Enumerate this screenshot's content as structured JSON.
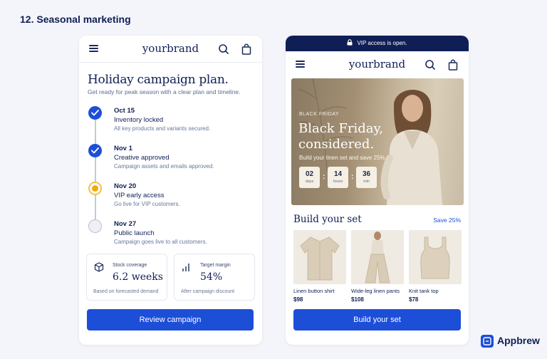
{
  "heading": "12. Seasonal marketing",
  "brand_logo": "yourbrand",
  "phone1": {
    "title": "Holiday campaign plan.",
    "subtitle": "Get ready for peak season with a clear plan and timeline.",
    "timeline": [
      {
        "date": "Oct 15",
        "name": "Inventory locked",
        "desc": "All key products and variants secured.",
        "status": "done"
      },
      {
        "date": "Nov 1",
        "name": "Creative approved",
        "desc": "Campaign assets and emails approved.",
        "status": "done"
      },
      {
        "date": "Nov 20",
        "name": "VIP early access",
        "desc": "Go live for VIP customers.",
        "status": "active"
      },
      {
        "date": "Nov 27",
        "name": "Public launch",
        "desc": "Campaign goes live to all customers.",
        "status": "pending"
      }
    ],
    "stats": [
      {
        "icon": "box-icon",
        "label": "Stock coverage",
        "value": "6.2 weeks",
        "foot": "Based on forecasted demand"
      },
      {
        "icon": "bar-chart-icon",
        "label": "Target margin",
        "value": "54%",
        "foot": "After campaign discount"
      }
    ],
    "cta": "Review campaign"
  },
  "phone2": {
    "banner": "VIP access is open.",
    "hero": {
      "tag": "BLACK FRIDAY",
      "title_line1": "Black Friday,",
      "title_line2": "considered.",
      "subtitle": "Build your linen set and save 25%.",
      "countdown": [
        {
          "value": "02",
          "unit": "days"
        },
        {
          "value": "14",
          "unit": "hours"
        },
        {
          "value": "36",
          "unit": "min"
        }
      ]
    },
    "set_title": "Build your set",
    "set_save": "Save 25%",
    "products": [
      {
        "name": "Linen button shirt",
        "price": "$98"
      },
      {
        "name": "Wide-leg linen pants",
        "price": "$108"
      },
      {
        "name": "Knit tank top",
        "price": "$78"
      }
    ],
    "cta": "Build your set"
  },
  "footer_brand": "Appbrew",
  "colors": {
    "accent": "#1d4ed8",
    "navy": "#0f1f55",
    "active_dot": "#f2a90f"
  }
}
